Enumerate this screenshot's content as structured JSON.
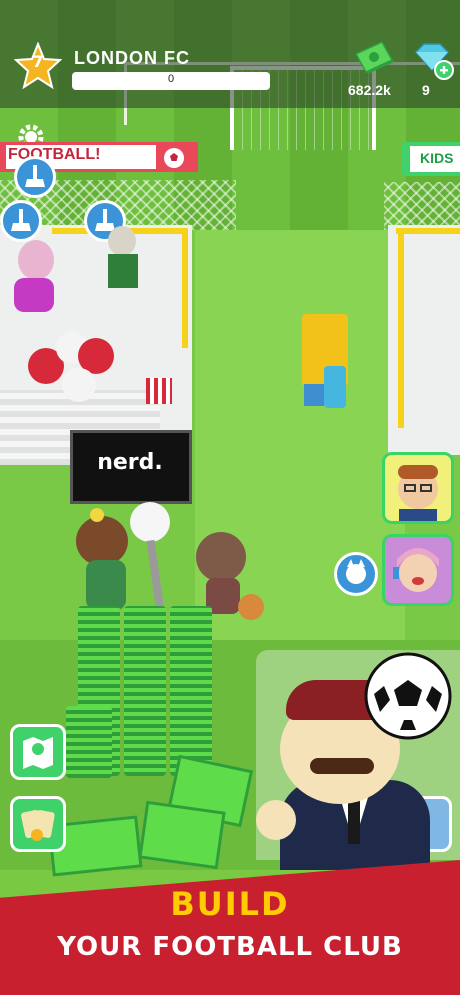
{
  "hud": {
    "level": "7",
    "club_name": "LONDON FC",
    "xp_value": "0",
    "cash": "682.2k",
    "gems": "9"
  },
  "signs": {
    "left": "FOOTBALL!",
    "right": "KIDS"
  },
  "sponsor": "nerd.",
  "banner": {
    "line1": "BUILD",
    "line2": "YOUR FOOTBALL CLUB"
  },
  "colors": {
    "accent_green": "#3fd16a",
    "banner_red": "#c9202f",
    "banner_yellow": "#ffcb05",
    "button_blue": "#3b93d8"
  },
  "icons": [
    "star-icon",
    "cash-icon",
    "gem-icon",
    "plus-icon",
    "settings-icon",
    "broom-icon",
    "map-icon",
    "cards-icon",
    "dog-icon",
    "soccer-ball-icon"
  ]
}
